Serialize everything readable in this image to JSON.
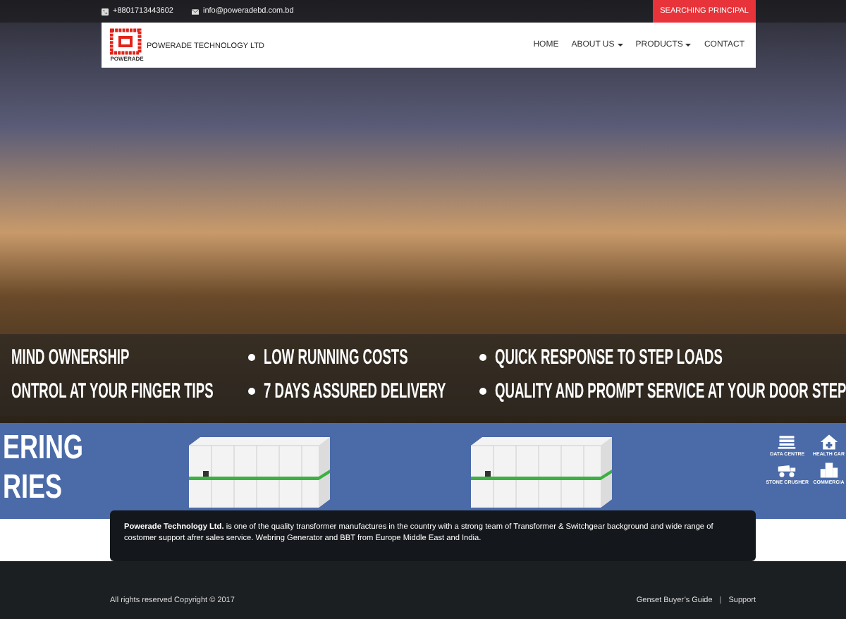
{
  "top_bar": {
    "phone": "+8801713443602",
    "email": "info@poweradebd.com.bd",
    "button": "SEARCHING PRINCIPAL"
  },
  "logo": {
    "mark": "POWERADE",
    "name": "POWERADE TECHNOLOGY LTD"
  },
  "nav": [
    {
      "label": "HOME",
      "dropdown": false
    },
    {
      "label": "ABOUT US",
      "dropdown": true
    },
    {
      "label": "PRODUCTS",
      "dropdown": true
    },
    {
      "label": "CONTACT",
      "dropdown": false
    }
  ],
  "features": [
    [
      {
        "text": "MIND OWNERSHIP",
        "bullet": false
      },
      {
        "text": "ONTROL AT YOUR FINGER TIPS",
        "bullet": false
      }
    ],
    [
      {
        "text": "LOW RUNNING COSTS",
        "bullet": true
      },
      {
        "text": "7 DAYS ASSURED DELIVERY",
        "bullet": true
      }
    ],
    [
      {
        "text": "QUICK RESPONSE TO STEP LOADS",
        "bullet": true
      },
      {
        "text": "QUALITY AND PROMPT SERVICE AT YOUR DOOR STEP",
        "bullet": true
      }
    ]
  ],
  "banner": {
    "title_lines": [
      "ERING",
      "RIES"
    ],
    "sectors": [
      {
        "label": "DATA CENTRE",
        "kind": "server"
      },
      {
        "label": "HEALTH CAR",
        "kind": "hospital"
      },
      {
        "label": "STONE CRUSHER",
        "kind": "truck"
      },
      {
        "label": "COMMERCIA",
        "kind": "office"
      }
    ]
  },
  "about": "**Powerade Technology Ltd.** is one of the quality transformer manufactures in the country with a strong team of Transformer & Switchgear background and wide range of costomer support afrer sales service. Webring  Generator and BBT from Europe Middle East and India.",
  "footer": {
    "copyright": "All rights reserved Copyright © 2017",
    "links": [
      "Genset Buyer’s Guide",
      "Support"
    ],
    "separator": "|"
  }
}
